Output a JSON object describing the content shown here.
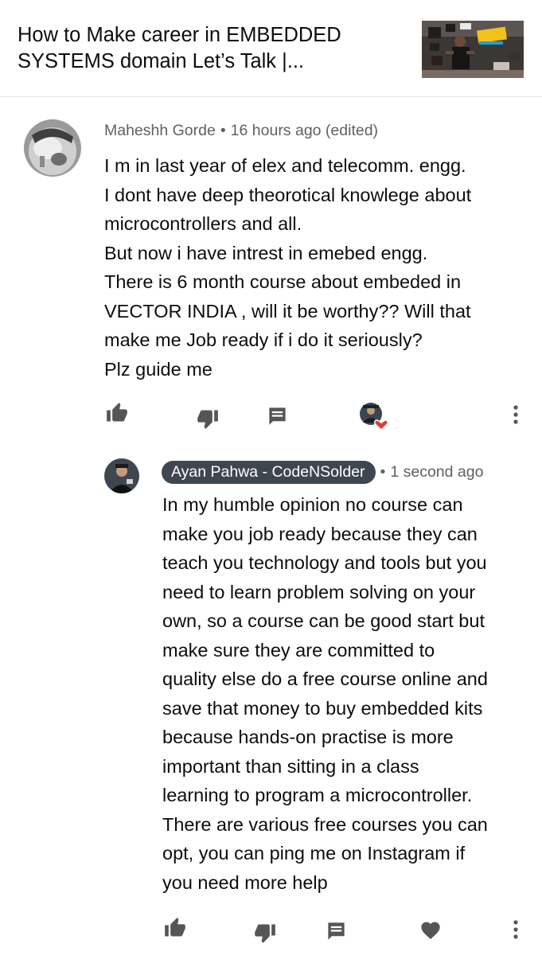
{
  "video": {
    "title": "How to Make career in EMBEDDED\nSYSTEMS domain   Let’s Talk |...",
    "thumbnail": "video-thumbnail"
  },
  "comment": {
    "author": "Maheshh Gorde",
    "separator": "•",
    "time": "16 hours ago (edited)",
    "text": "I m in last year of elex and telecomm. engg.\nI dont have deep theorotical knowlege about\nmicrocontrollers and all.\nBut now i have intrest in emebed engg.\nThere is 6 month course about embeded in\nVECTOR INDIA , will it be worthy?? Will that\nmake me Job ready if i do it seriously?\nPlz guide me",
    "icons": [
      "like-icon",
      "dislike-icon",
      "reply-icon",
      "creator-heart-icon",
      "more-icon"
    ]
  },
  "reply": {
    "author": "Ayan Pahwa - CodeNSolder",
    "separator": "•",
    "time": "1 second ago",
    "text": "In my humble opinion no course can\nmake you job ready because they can\nteach you technology and tools but you\nneed to learn problem solving on your\nown, so a course can be good start but\nmake sure they are committed to\nquality else do a free course online and\nsave that money to buy embedded kits\nbecause hands-on practise is more\nimportant than sitting in a class\nlearning to program a microcontroller.\nThere are various free courses you can\nopt, you can ping me on Instagram if\nyou need more help",
    "icons": [
      "like-icon",
      "dislike-icon",
      "reply-icon",
      "heart-icon",
      "more-icon"
    ]
  },
  "colors": {
    "icon": "#555555",
    "heart": "#e53935",
    "badge_bg": "#3e4650",
    "meta": "#606060"
  }
}
